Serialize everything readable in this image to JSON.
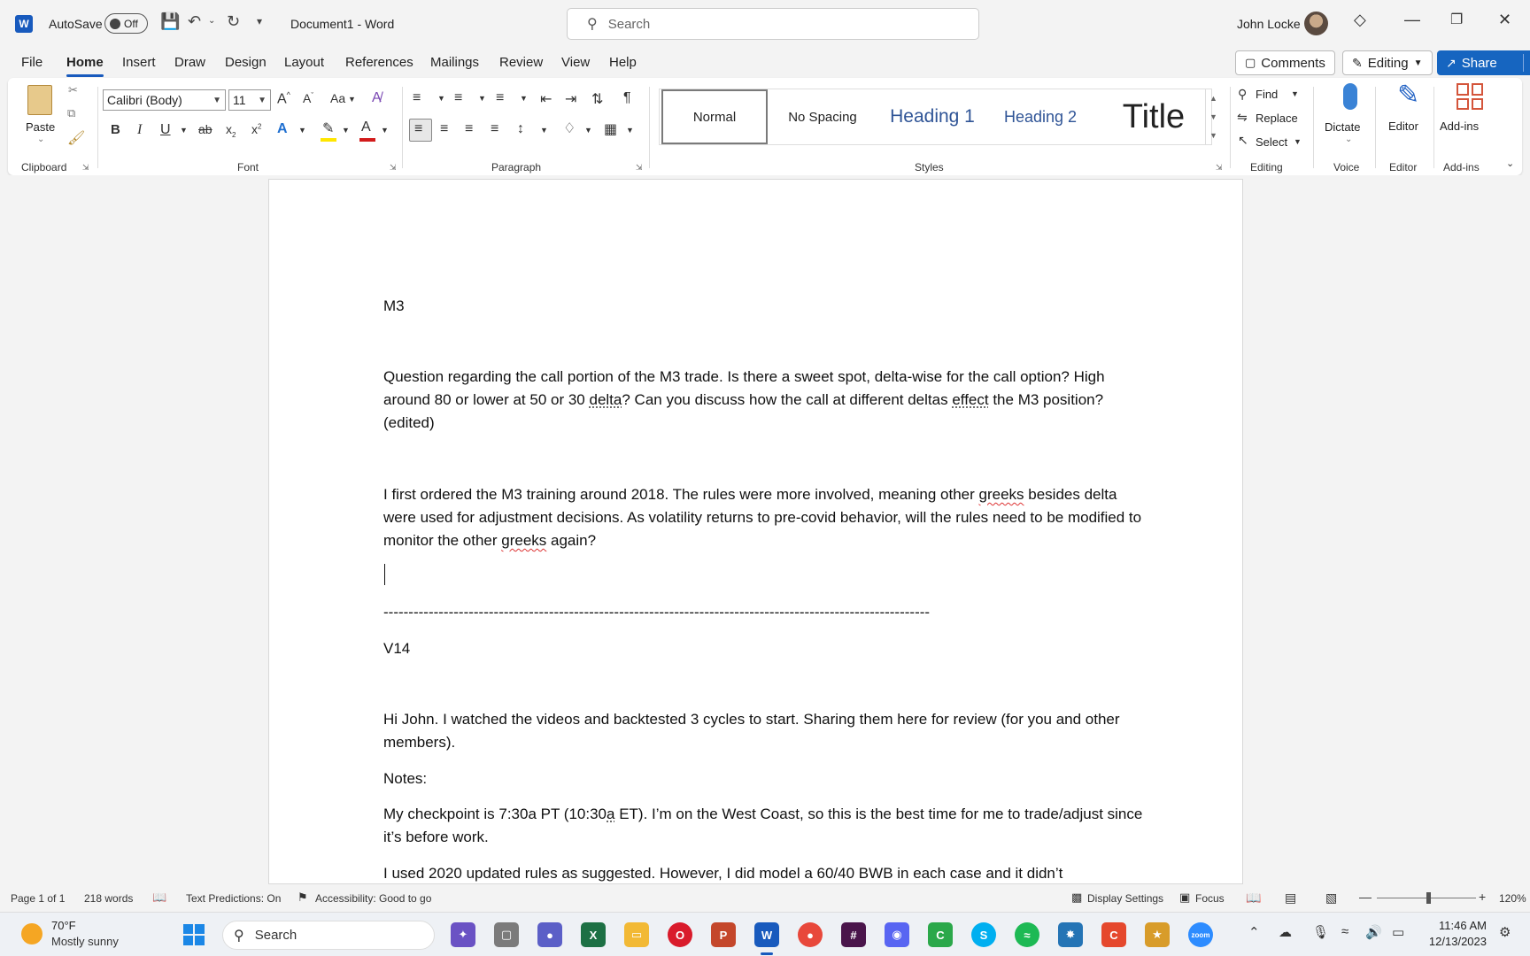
{
  "titlebar": {
    "autosave_label": "AutoSave",
    "autosave_state": "Off",
    "doc_title": "Document1  -  Word",
    "search_placeholder": "Search",
    "user_name": "John Locke"
  },
  "menu": {
    "tabs": [
      "File",
      "Home",
      "Insert",
      "Draw",
      "Design",
      "Layout",
      "References",
      "Mailings",
      "Review",
      "View",
      "Help"
    ],
    "active": "Home",
    "comments_label": "Comments",
    "editing_label": "Editing",
    "share_label": "Share"
  },
  "ribbon": {
    "clipboard": {
      "paste_label": "Paste",
      "group_label": "Clipboard"
    },
    "font": {
      "font_name": "Calibri (Body)",
      "font_size": "11",
      "group_label": "Font",
      "change_case": "Aa"
    },
    "paragraph": {
      "group_label": "Paragraph"
    },
    "styles": {
      "group_label": "Styles",
      "items": [
        "Normal",
        "No Spacing",
        "Heading 1",
        "Heading 2",
        "Title"
      ]
    },
    "editing": {
      "find": "Find",
      "replace": "Replace",
      "select": "Select",
      "group_label": "Editing"
    },
    "voice": {
      "dictate": "Dictate",
      "group_label": "Voice"
    },
    "editor": {
      "label": "Editor",
      "group_label": "Editor"
    },
    "addins": {
      "label": "Add-ins",
      "group_label": "Add-ins"
    }
  },
  "document": {
    "heading_m3": "M3",
    "q1_part1": "Question regarding the call portion of the M3 trade. Is there a sweet spot, delta-wise for the call option? High around 80 or lower at 50 or 30 ",
    "q1_delta": "delta",
    "q1_part2": "? Can you discuss how the call at different deltas ",
    "q1_effect": "effect",
    "q1_part3": " the M3 position? (edited)",
    "q2_part1": "I first ordered the M3 training around 2018. The rules were more involved, meaning other ",
    "q2_greeks1": "greeks",
    "q2_part2": " besides delta were used for adjustment decisions. As volatility returns to pre-covid behavior, will the rules need to be modified to monitor the other ",
    "q2_greeks2": "greeks",
    "q2_part3": " again?",
    "divider": "-------------------------------------------------------------------------------------------------------------",
    "heading_v14": "V14",
    "v1": "Hi John. I watched the videos and backtested 3 cycles to start. Sharing them here for review (for you and other members).",
    "notes": "Notes:",
    "v2_part1": "My checkpoint is 7:30a PT (10:30",
    "v2_a": "a",
    "v2_part2": " ET). I’m on the West Coast, so this is the best time for me to trade/adjust since it’s before work.",
    "v3": "I used 2020 updated rules as suggested. However, I did model a 60/40 BWB in each case and it didn’t"
  },
  "status": {
    "page": "Page 1 of 1",
    "words": "218 words",
    "text_predictions": "Text Predictions: On",
    "accessibility": "Accessibility: Good to go",
    "display_settings": "Display Settings",
    "focus": "Focus",
    "zoom": "120%",
    "zoom_fraction": 0.52
  },
  "taskbar": {
    "weather_temp": "70°F",
    "weather_desc": "Mostly sunny",
    "search_label": "Search",
    "time": "11:46 AM",
    "date": "12/13/2023"
  }
}
